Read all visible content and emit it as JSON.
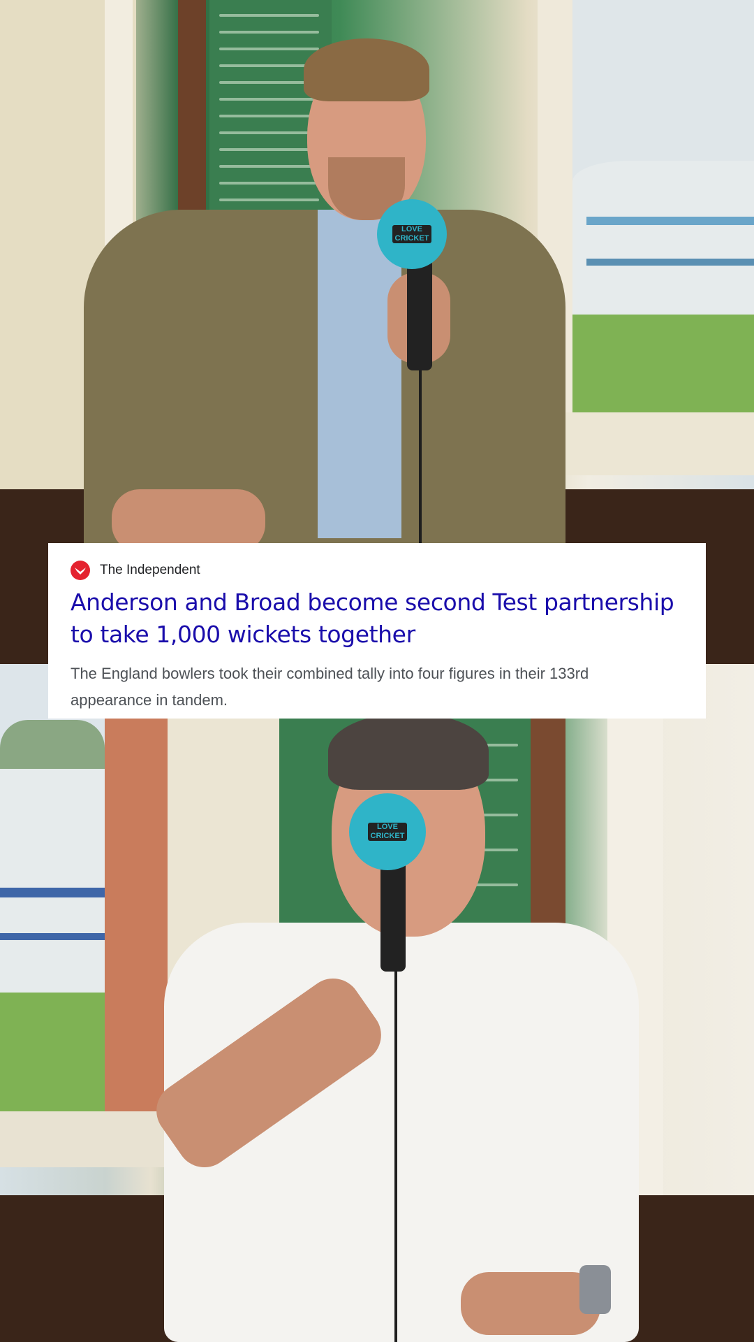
{
  "news_card": {
    "source": "The Independent",
    "source_color": "#e4222f",
    "title": "Anderson and Broad become second Test partnership to take 1,000 wickets together",
    "title_color": "#1a0dab",
    "snippet": "The England bowlers took their combined tally into four figures in their 133rd appearance in tandem."
  },
  "microphone": {
    "brand_top": "LOVE",
    "brand_bottom": "CRICKET",
    "color": "#2fb4c8"
  }
}
